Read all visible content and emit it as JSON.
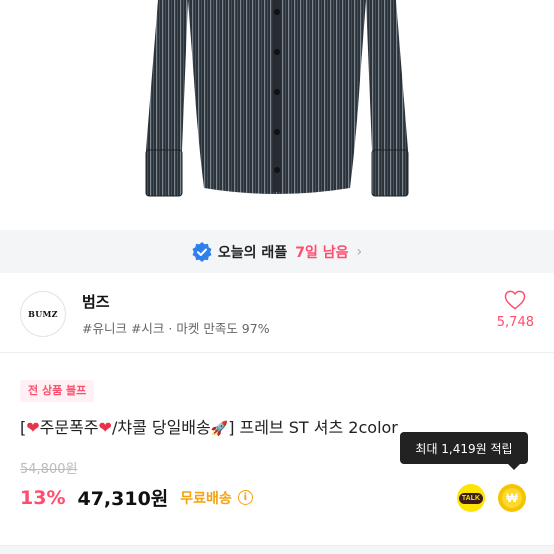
{
  "raffle": {
    "label": "오늘의 래플",
    "days_left": "7일 남음",
    "chevron": "›"
  },
  "shop": {
    "logo_text": "BUMZ",
    "name": "범즈",
    "tags": "#유니크 #시크 · 마켓 만족도 97%",
    "like_count": "5,748"
  },
  "product": {
    "badge": "전 상품 블프",
    "title_parts": {
      "open_bracket": "[",
      "heart1": "❤",
      "phrase1": "주문폭주",
      "heart2": "❤",
      "phrase2": "/챠콜 당일배송",
      "rocket": "🚀",
      "rest": "] 프레브 ST 셔츠 2color"
    },
    "original_price": "54,800원",
    "discount": "13%",
    "price": "47,310원",
    "free_shipping": "무료배송",
    "info_icon": "i"
  },
  "tooltip": {
    "text": "최대 1,419원 적립"
  },
  "actions": {
    "talk_label": "TALK",
    "point_symbol": "₩"
  },
  "colors": {
    "accent": "#ff4d6d",
    "shipping": "#f4a312",
    "verified": "#2f80ed",
    "kakao_yellow": "#fee500",
    "point_yellow": "#f5c400"
  }
}
